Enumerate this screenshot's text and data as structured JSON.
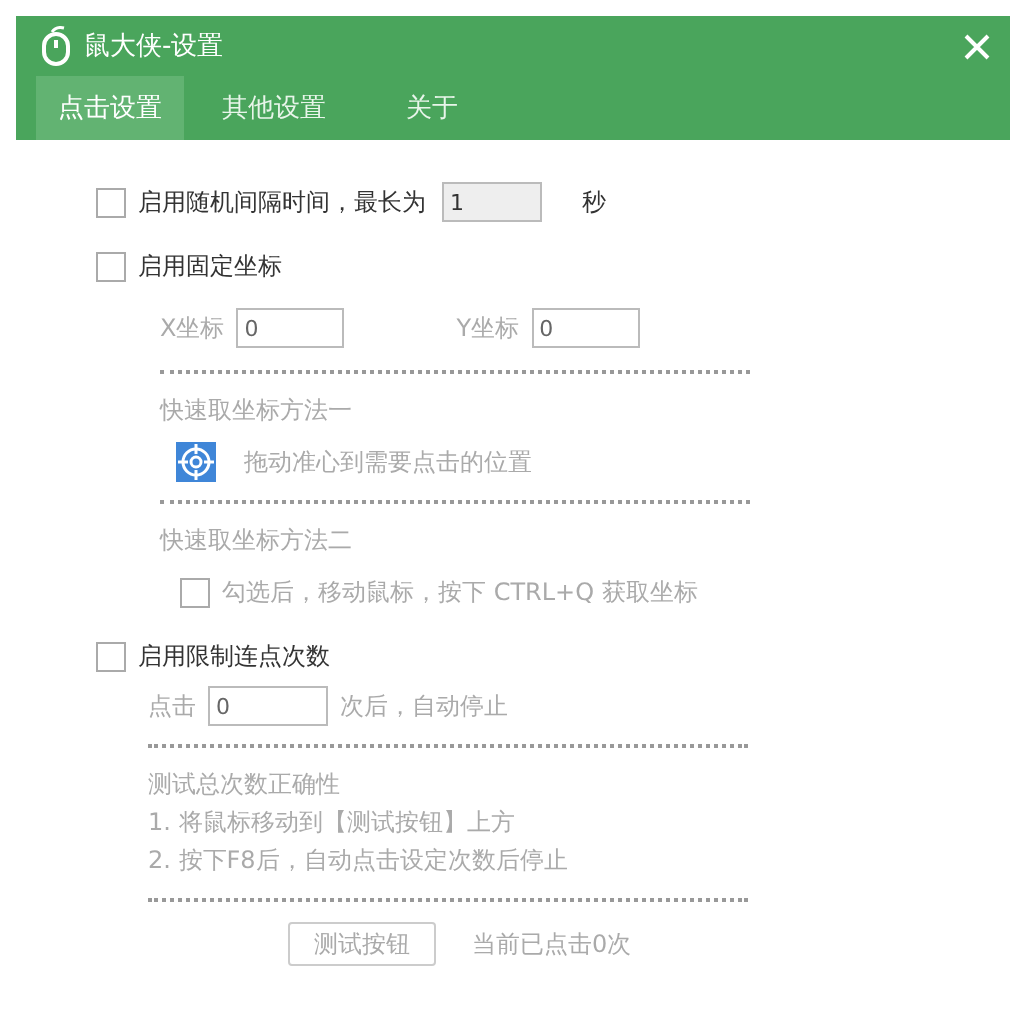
{
  "window": {
    "title": "鼠大侠-设置"
  },
  "tabs": [
    {
      "label": "点击设置",
      "selected": true
    },
    {
      "label": "其他设置",
      "selected": false
    },
    {
      "label": "关于",
      "selected": false
    }
  ],
  "random_interval": {
    "label": "启用随机间隔时间，最长为",
    "checked": false,
    "value": "1",
    "unit": "秒"
  },
  "fixed_coords": {
    "label": "启用固定坐标",
    "checked": false,
    "x_label": "X坐标",
    "x_value": "0",
    "y_label": "Y坐标",
    "y_value": "0",
    "method1_title": "快速取坐标方法一",
    "method1_hint": "拖动准心到需要点击的位置",
    "method2_title": "快速取坐标方法二",
    "method2_option": {
      "label": "勾选后，移动鼠标，按下 CTRL+Q 获取坐标",
      "checked": false
    }
  },
  "click_limit": {
    "label": "启用限制连点次数",
    "checked": false,
    "count_prefix": "点击",
    "count_value": "0",
    "count_suffix": "次后，自动停止",
    "test_title": "测试总次数正确性",
    "steps": [
      "1. 将鼠标移动到【测试按钮】上方",
      "2. 按下F8后，自动点击设定次数后停止"
    ],
    "test_button": "测试按钮",
    "status": "当前已点击0次"
  }
}
